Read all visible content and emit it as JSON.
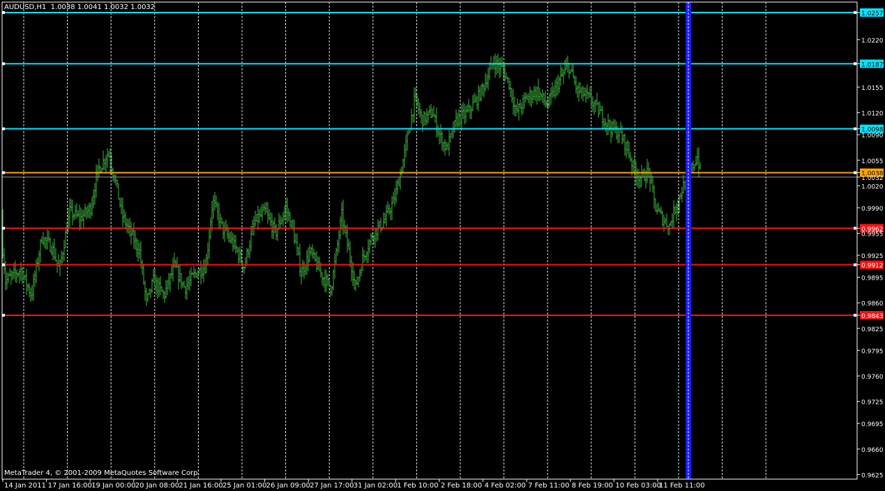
{
  "header": {
    "symbol_timeframe": "AUDUSD,H1",
    "ohlc": "1.0038 1.0041 1.0032 1.0032"
  },
  "copyright": "MetaTrader 4, © 2001-2009 MetaQuotes Software Corp.",
  "colors": {
    "background": "#000000",
    "candles": "#3fb940",
    "axis": "#ffffff",
    "grid": "#ffffff",
    "resistance": "#00e5ff",
    "support": "#ff1010",
    "current": "#ffa500",
    "vline": "#1a1aff"
  },
  "chart_data": {
    "type": "bar",
    "price_axis": {
      "range": [
        0.961,
        1.028
      ],
      "ticks": [
        "1.0257",
        "1.0220",
        "1.0187",
        "1.0155",
        "1.0120",
        "1.0098",
        "1.0090",
        "1.0055",
        "1.0038",
        "1.0032",
        "1.0020",
        "0.9990",
        "0.9962",
        "0.9955",
        "0.9925",
        "0.9912",
        "0.9895",
        "0.9860",
        "0.9843",
        "0.9825",
        "0.9795",
        "0.9760",
        "0.9725",
        "0.9695",
        "0.9660",
        "0.9625"
      ]
    },
    "time_axis": {
      "labels": [
        "14 Jan 2011",
        "17 Jan 16:00",
        "19 Jan 00:00",
        "20 Jan 08:00",
        "21 Jan 16:00",
        "25 Jan 01:00",
        "26 Jan 09:00",
        "27 Jan 17:00",
        "31 Jan 02:00",
        "1 Feb 10:00",
        "2 Feb 18:00",
        "4 Feb 02:00",
        "7 Feb 11:00",
        "8 Feb 19:00",
        "10 Feb 03:00",
        "11 Feb 11:00"
      ]
    },
    "horizontal_levels": [
      {
        "price": 1.0257,
        "label": "1.0257",
        "kind": "resistance"
      },
      {
        "price": 1.0187,
        "label": "1.0187",
        "kind": "resistance"
      },
      {
        "price": 1.0098,
        "label": "1.0098",
        "kind": "resistance"
      },
      {
        "price": 1.0038,
        "label": "1.0038",
        "kind": "current"
      },
      {
        "price": 0.9962,
        "label": "0.9962",
        "kind": "support"
      },
      {
        "price": 0.9912,
        "label": "0.9912",
        "kind": "support"
      },
      {
        "price": 0.9843,
        "label": "0.9843",
        "kind": "support"
      }
    ],
    "last_price": {
      "price": 1.0032,
      "label": "1.0032"
    },
    "vertical_marker_label": "11 Feb 11:00",
    "price_path": [
      [
        0,
        0.9975
      ],
      [
        8,
        0.989
      ],
      [
        30,
        0.9905
      ],
      [
        45,
        0.987
      ],
      [
        60,
        0.995
      ],
      [
        75,
        0.9935
      ],
      [
        85,
        0.9905
      ],
      [
        100,
        0.9985
      ],
      [
        115,
        0.9975
      ],
      [
        130,
        0.999
      ],
      [
        140,
        1.004
      ],
      [
        155,
        1.0065
      ],
      [
        165,
        1.003
      ],
      [
        175,
        0.998
      ],
      [
        185,
        0.996
      ],
      [
        200,
        0.993
      ],
      [
        210,
        0.986
      ],
      [
        220,
        0.989
      ],
      [
        235,
        0.987
      ],
      [
        250,
        0.991
      ],
      [
        265,
        0.988
      ],
      [
        280,
        0.99
      ],
      [
        295,
        0.991
      ],
      [
        305,
        1.0
      ],
      [
        320,
        0.996
      ],
      [
        335,
        0.994
      ],
      [
        350,
        0.991
      ],
      [
        365,
        0.997
      ],
      [
        380,
        0.9985
      ],
      [
        395,
        0.9955
      ],
      [
        410,
        0.999
      ],
      [
        420,
        0.996
      ],
      [
        432,
        0.99
      ],
      [
        445,
        0.993
      ],
      [
        460,
        0.99
      ],
      [
        475,
        0.988
      ],
      [
        490,
        0.998
      ],
      [
        500,
        0.993
      ],
      [
        510,
        0.988
      ],
      [
        520,
        0.992
      ],
      [
        535,
        0.9955
      ],
      [
        550,
        0.997
      ],
      [
        565,
        1.0
      ],
      [
        575,
        1.004
      ],
      [
        585,
        1.009
      ],
      [
        595,
        1.014
      ],
      [
        605,
        1.011
      ],
      [
        620,
        1.012
      ],
      [
        630,
        1.009
      ],
      [
        640,
        1.007
      ],
      [
        655,
        1.011
      ],
      [
        670,
        1.012
      ],
      [
        685,
        1.014
      ],
      [
        695,
        1.016
      ],
      [
        708,
        1.019
      ],
      [
        720,
        1.018
      ],
      [
        730,
        1.016
      ],
      [
        740,
        1.012
      ],
      [
        755,
        1.014
      ],
      [
        770,
        1.015
      ],
      [
        785,
        1.013
      ],
      [
        800,
        1.016
      ],
      [
        815,
        1.0185
      ],
      [
        828,
        1.015
      ],
      [
        845,
        1.014
      ],
      [
        860,
        1.012
      ],
      [
        875,
        1.01
      ],
      [
        890,
        1.009
      ],
      [
        900,
        1.007
      ],
      [
        910,
        1.004
      ],
      [
        920,
        1.003
      ],
      [
        930,
        1.004
      ],
      [
        940,
        0.999
      ],
      [
        950,
        0.9975
      ],
      [
        960,
        0.9965
      ],
      [
        970,
        0.9995
      ],
      [
        980,
        1.002
      ],
      [
        990,
        1.004
      ],
      [
        1000,
        1.006
      ],
      [
        1005,
        1.0035
      ]
    ]
  }
}
